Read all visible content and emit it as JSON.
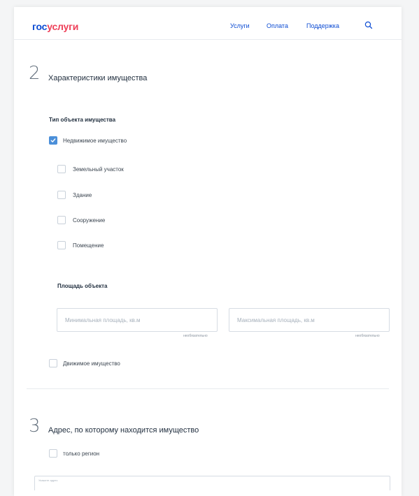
{
  "header": {
    "logo_part1": "гос",
    "logo_part2": "услуги",
    "nav": {
      "services": "Услуги",
      "payment": "Оплата",
      "support": "Поддержка"
    }
  },
  "section2": {
    "number": "2",
    "title": "Характеристики имущества",
    "property_type_label": "Тип объекта имущества",
    "real_estate": {
      "label": "Недвижимое имущество",
      "checked": true
    },
    "sub_options": [
      {
        "label": "Земельный участок",
        "checked": false
      },
      {
        "label": "Здание",
        "checked": false
      },
      {
        "label": "Сооружение",
        "checked": false
      },
      {
        "label": "Помещение",
        "checked": false
      }
    ],
    "area": {
      "label": "Площадь объекта",
      "min_placeholder": "Минимальная площадь, кв.м",
      "max_placeholder": "Максимальная площадь, кв.м",
      "optional_note": "необязательно"
    },
    "movable": {
      "label": "Движимое имущество",
      "checked": false
    }
  },
  "section3": {
    "number": "3",
    "title": "Адрес, по которому находится имущество",
    "region_only": {
      "label": "только регион",
      "checked": false
    },
    "address_field_label": "Укажите адрес"
  },
  "colors": {
    "brand_blue": "#0d4cd3",
    "brand_red": "#ee3f58",
    "checkbox_checked": "#4b8fd9"
  }
}
